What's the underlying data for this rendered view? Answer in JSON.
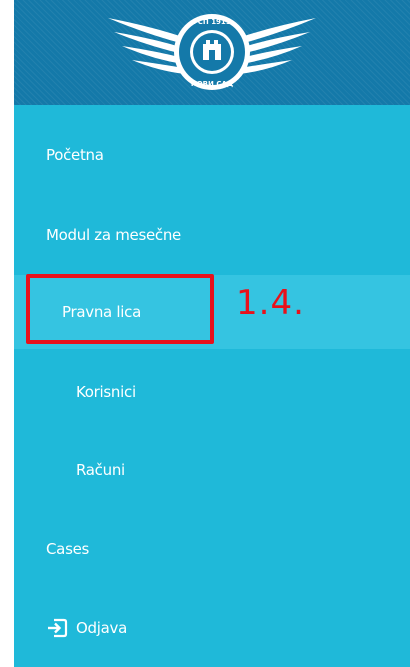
{
  "logo": {
    "seal_text": "ГСП 1911 НОВИ САД"
  },
  "nav": {
    "pocetna": "Početna",
    "modul": "Modul za mesečne",
    "pravna_lica": "Pravna lica",
    "korisnici": "Korisnici",
    "racuni": "Računi",
    "cases": "Cases",
    "odjava": "Odjava"
  },
  "annotation": {
    "label": "1.4."
  },
  "colors": {
    "sidebar": "#1fb9d9",
    "header": "#1479a9",
    "active_row": "#35c4e1",
    "annotation_red": "#e8111b"
  },
  "icons": {
    "logout": "logout-icon"
  }
}
